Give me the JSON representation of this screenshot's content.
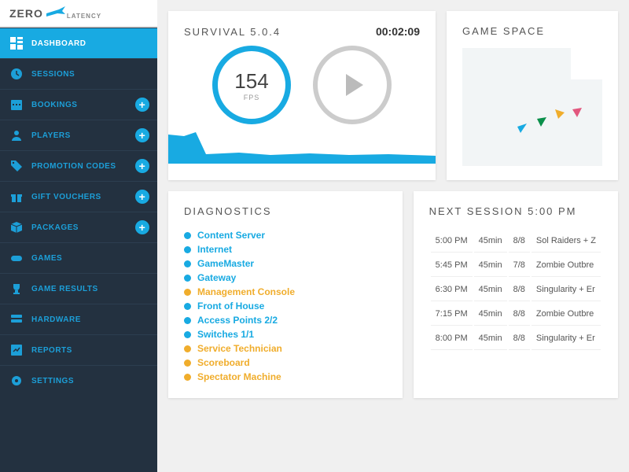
{
  "brand": {
    "zero": "ZERO",
    "latency": "LATENCY"
  },
  "nav": [
    {
      "label": "DASHBOARD",
      "name": "dashboard",
      "active": true,
      "plus": false,
      "icon": "grid"
    },
    {
      "label": "SESSIONS",
      "name": "sessions",
      "active": false,
      "plus": false,
      "icon": "clock"
    },
    {
      "label": "BOOKINGS",
      "name": "bookings",
      "active": false,
      "plus": true,
      "icon": "calendar"
    },
    {
      "label": "PLAYERS",
      "name": "players",
      "active": false,
      "plus": true,
      "icon": "player"
    },
    {
      "label": "PROMOTION CODES",
      "name": "promotion-codes",
      "active": false,
      "plus": true,
      "icon": "tag"
    },
    {
      "label": "GIFT VOUCHERS",
      "name": "gift-vouchers",
      "active": false,
      "plus": true,
      "icon": "gift"
    },
    {
      "label": "PACKAGES",
      "name": "packages",
      "active": false,
      "plus": true,
      "icon": "box"
    },
    {
      "label": "GAMES",
      "name": "games",
      "active": false,
      "plus": false,
      "icon": "gamepad"
    },
    {
      "label": "GAME RESULTS",
      "name": "game-results",
      "active": false,
      "plus": false,
      "icon": "trophy"
    },
    {
      "label": "HARDWARE",
      "name": "hardware",
      "active": false,
      "plus": false,
      "icon": "server"
    },
    {
      "label": "REPORTS",
      "name": "reports",
      "active": false,
      "plus": false,
      "icon": "chart"
    },
    {
      "label": "SETTINGS",
      "name": "settings",
      "active": false,
      "plus": false,
      "icon": "gear"
    }
  ],
  "survival": {
    "title": "SURVIVAL 5.0.4",
    "timer": "00:02:09",
    "fps_value": "154",
    "fps_label": "FPS"
  },
  "gameSpace": {
    "title": "GAME SPACE"
  },
  "diagnostics": {
    "title": "DIAGNOSTICS",
    "items": [
      {
        "label": "Content Server",
        "status": "ok"
      },
      {
        "label": "Internet",
        "status": "ok"
      },
      {
        "label": "GameMaster",
        "status": "ok"
      },
      {
        "label": "Gateway",
        "status": "ok"
      },
      {
        "label": "Management Console",
        "status": "warn"
      },
      {
        "label": "Front of House",
        "status": "ok"
      },
      {
        "label": "Access Points 2/2",
        "status": "ok"
      },
      {
        "label": "Switches 1/1",
        "status": "ok"
      },
      {
        "label": "Service Technician",
        "status": "warn"
      },
      {
        "label": "Scoreboard",
        "status": "warn"
      },
      {
        "label": "Spectator Machine",
        "status": "warn"
      }
    ]
  },
  "nextSession": {
    "title": "NEXT SESSION 5:00 PM",
    "rows": [
      {
        "time": "5:00 PM",
        "dur": "45min",
        "cap": "8/8",
        "game": "Sol Raiders + Z"
      },
      {
        "time": "5:45 PM",
        "dur": "45min",
        "cap": "7/8",
        "game": "Zombie Outbre"
      },
      {
        "time": "6:30 PM",
        "dur": "45min",
        "cap": "8/8",
        "game": "Singularity + Er"
      },
      {
        "time": "7:15 PM",
        "dur": "45min",
        "cap": "8/8",
        "game": "Zombie Outbre"
      },
      {
        "time": "8:00 PM",
        "dur": "45min",
        "cap": "8/8",
        "game": "Singularity + Er"
      }
    ]
  },
  "colors": {
    "accent": "#18aae2",
    "warn": "#f0ad2c",
    "sidebar": "#233140"
  }
}
